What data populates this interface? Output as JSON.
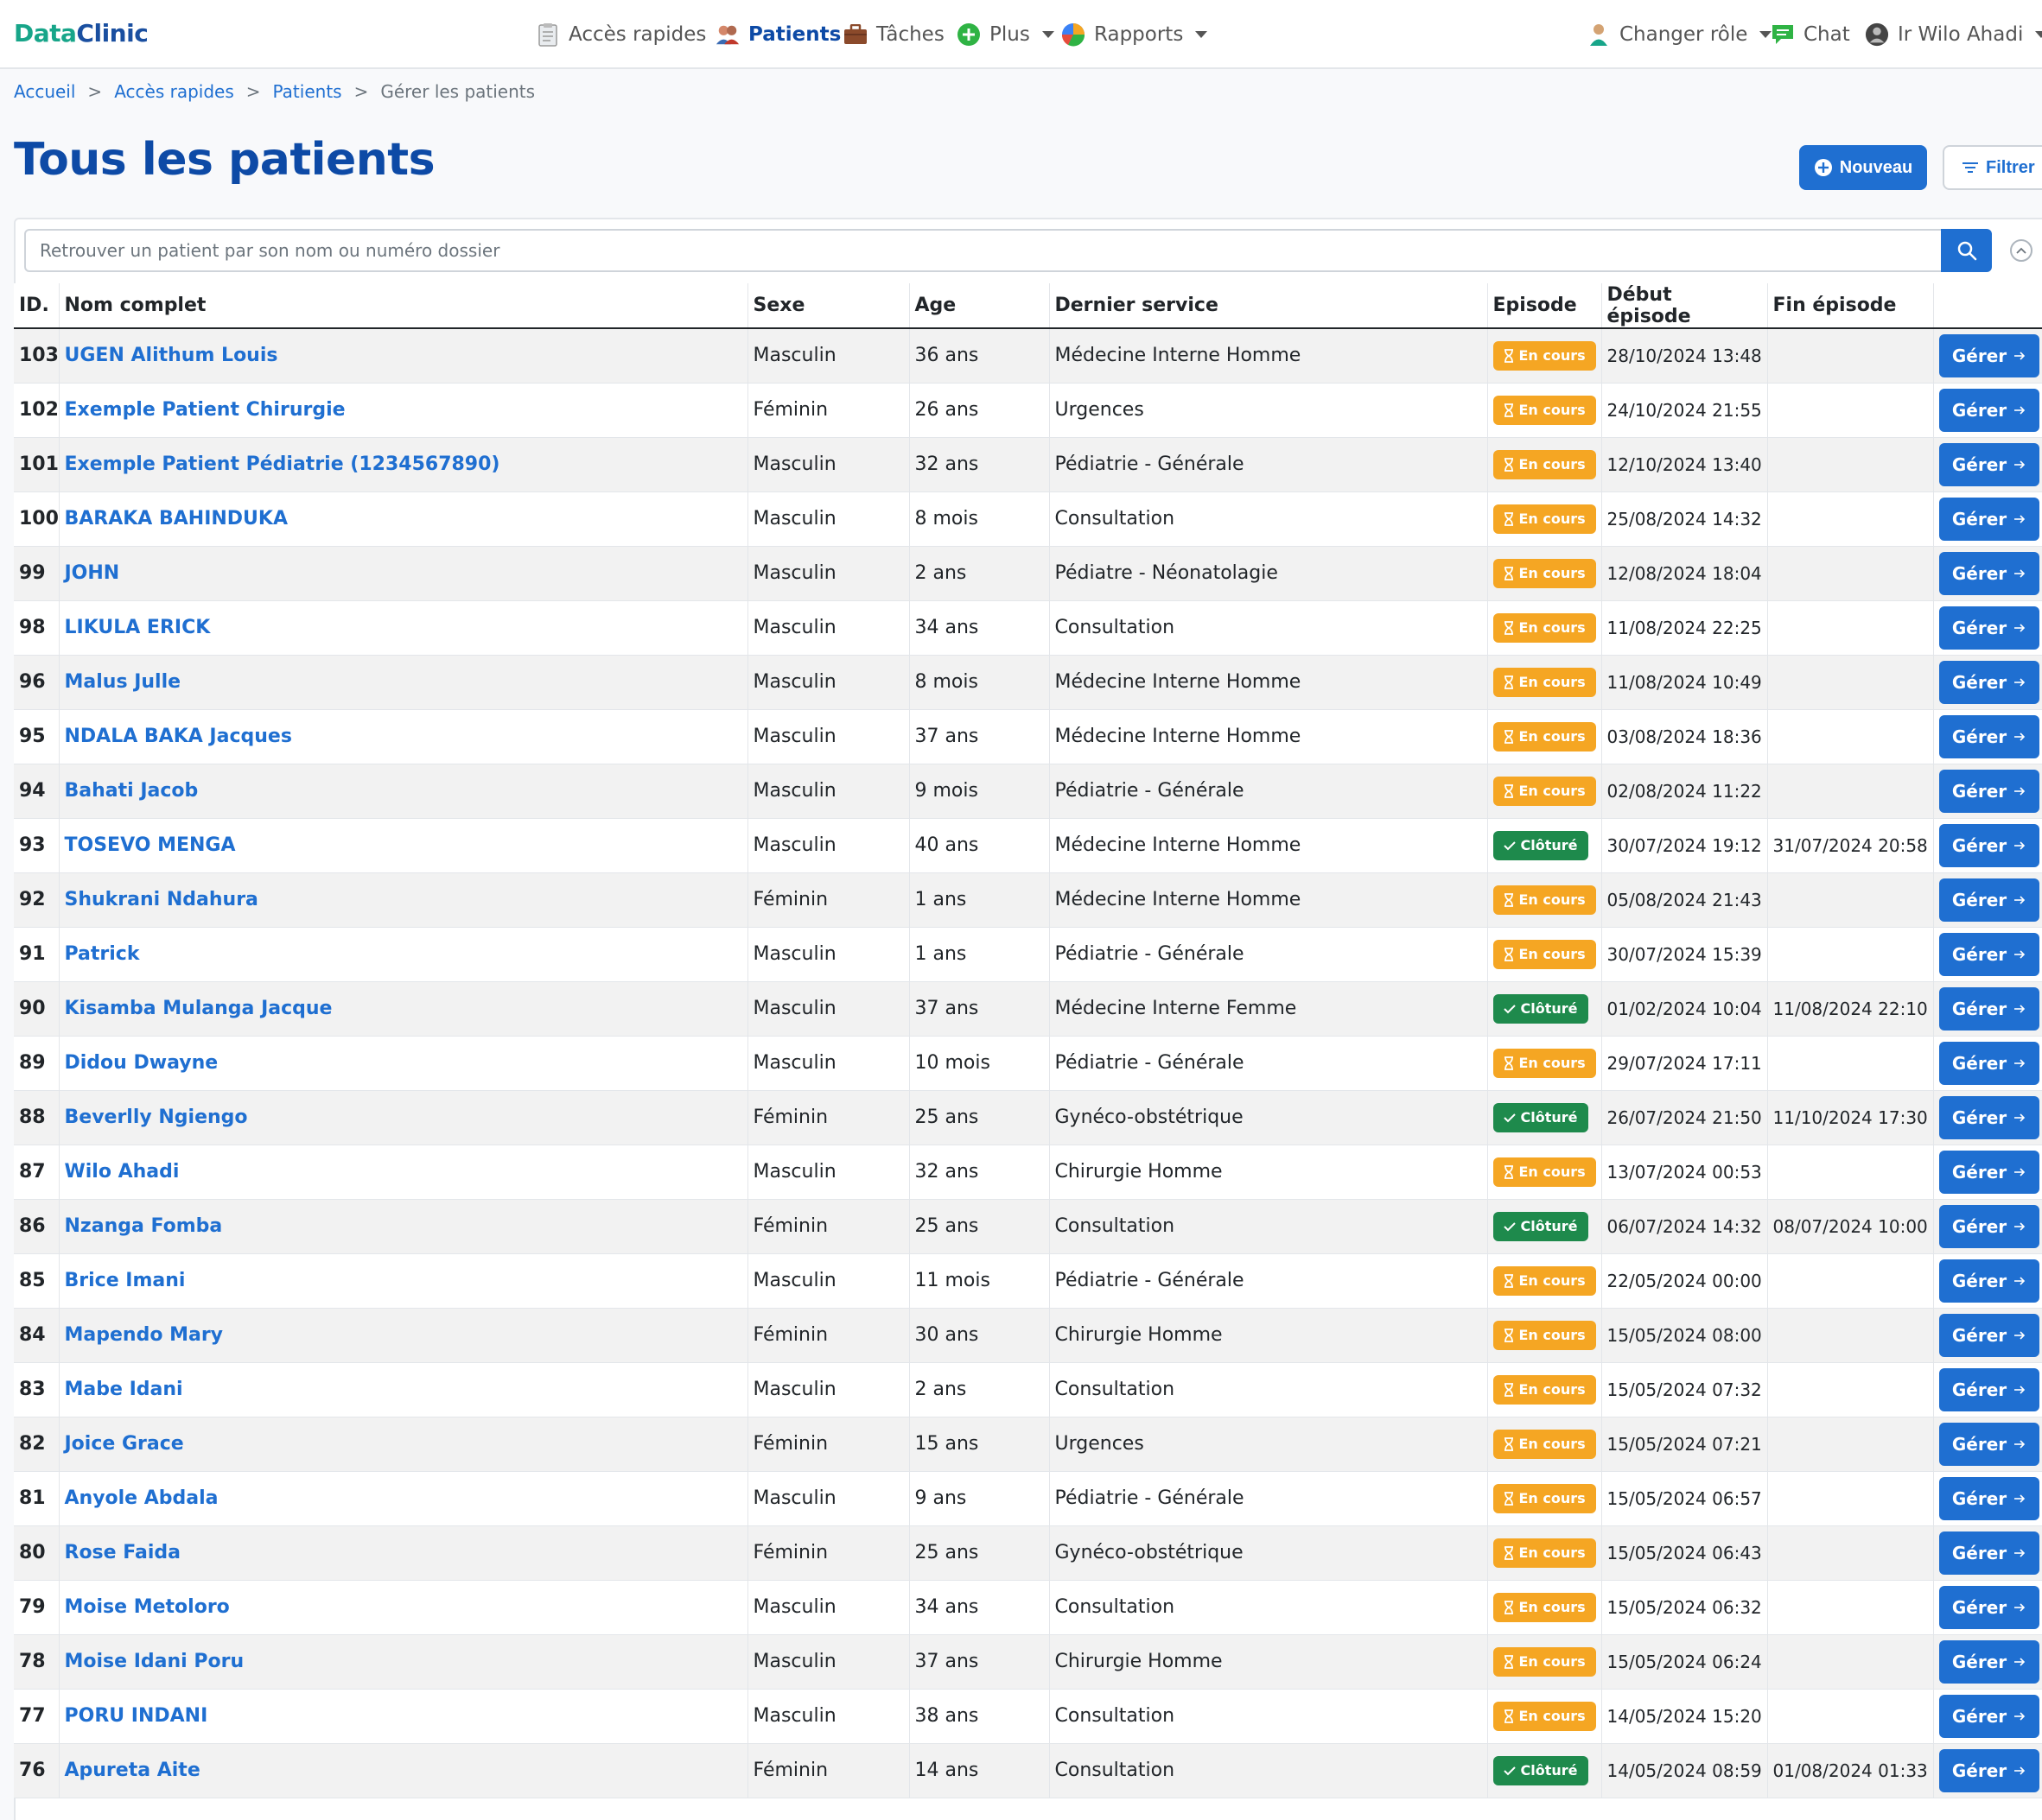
{
  "nav": {
    "brand_a": "Data",
    "brand_b": "Clinic",
    "quick_access": "Accès rapides",
    "patients": "Patients",
    "tasks": "Tâches",
    "more": "Plus",
    "reports": "Rapports",
    "change_role": "Changer rôle",
    "chat": "Chat",
    "user": "Ir Wilo Ahadi"
  },
  "breadcrumb": [
    "Accueil",
    "Accès rapides",
    "Patients",
    "Gérer les patients"
  ],
  "page": {
    "title": "Tous les patients",
    "new_label": "Nouveau",
    "filter_label": "Filtrer"
  },
  "search": {
    "placeholder": "Retrouver un patient par son nom ou numéro dossier"
  },
  "table": {
    "headers": [
      "ID.",
      "Nom complet",
      "Sexe",
      "Age",
      "Dernier service",
      "Episode",
      "Début épisode",
      "Fin épisode",
      ""
    ],
    "manage_label": "Gérer",
    "rows": [
      {
        "id": "103",
        "name": "UGEN Alithum Louis",
        "sex": "Masculin",
        "age": "36 ans",
        "service": "Médecine Interne Homme",
        "status": "En cours",
        "start": "28/10/2024 13:48",
        "end": ""
      },
      {
        "id": "102",
        "name": "Exemple Patient Chirurgie",
        "sex": "Féminin",
        "age": "26 ans",
        "service": "Urgences",
        "status": "En cours",
        "start": "24/10/2024 21:55",
        "end": ""
      },
      {
        "id": "101",
        "name": "Exemple Patient Pédiatrie (1234567890)",
        "sex": "Masculin",
        "age": "32 ans",
        "service": "Pédiatrie - Générale",
        "status": "En cours",
        "start": "12/10/2024 13:40",
        "end": ""
      },
      {
        "id": "100",
        "name": "BARAKA BAHINDUKA",
        "sex": "Masculin",
        "age": "8 mois",
        "service": "Consultation",
        "status": "En cours",
        "start": "25/08/2024 14:32",
        "end": ""
      },
      {
        "id": "99",
        "name": "JOHN",
        "sex": "Masculin",
        "age": "2 ans",
        "service": "Pédiatre - Néonatolagie",
        "status": "En cours",
        "start": "12/08/2024 18:04",
        "end": ""
      },
      {
        "id": "98",
        "name": "LIKULA ERICK",
        "sex": "Masculin",
        "age": "34 ans",
        "service": "Consultation",
        "status": "En cours",
        "start": "11/08/2024 22:25",
        "end": ""
      },
      {
        "id": "96",
        "name": "Malus Julle",
        "sex": "Masculin",
        "age": "8 mois",
        "service": "Médecine Interne Homme",
        "status": "En cours",
        "start": "11/08/2024 10:49",
        "end": ""
      },
      {
        "id": "95",
        "name": "NDALA BAKA Jacques",
        "sex": "Masculin",
        "age": "37 ans",
        "service": "Médecine Interne Homme",
        "status": "En cours",
        "start": "03/08/2024 18:36",
        "end": ""
      },
      {
        "id": "94",
        "name": "Bahati Jacob",
        "sex": "Masculin",
        "age": "9 mois",
        "service": "Pédiatrie - Générale",
        "status": "En cours",
        "start": "02/08/2024 11:22",
        "end": ""
      },
      {
        "id": "93",
        "name": "TOSEVO MENGA",
        "sex": "Masculin",
        "age": "40 ans",
        "service": "Médecine Interne Homme",
        "status": "Clôturé",
        "start": "30/07/2024 19:12",
        "end": "31/07/2024 20:58"
      },
      {
        "id": "92",
        "name": "Shukrani Ndahura",
        "sex": "Féminin",
        "age": "1 ans",
        "service": "Médecine Interne Homme",
        "status": "En cours",
        "start": "05/08/2024 21:43",
        "end": ""
      },
      {
        "id": "91",
        "name": "Patrick",
        "sex": "Masculin",
        "age": "1 ans",
        "service": "Pédiatrie - Générale",
        "status": "En cours",
        "start": "30/07/2024 15:39",
        "end": ""
      },
      {
        "id": "90",
        "name": "Kisamba Mulanga Jacque",
        "sex": "Masculin",
        "age": "37 ans",
        "service": "Médecine Interne Femme",
        "status": "Clôturé",
        "start": "01/02/2024 10:04",
        "end": "11/08/2024 22:10"
      },
      {
        "id": "89",
        "name": "Didou Dwayne",
        "sex": "Masculin",
        "age": "10 mois",
        "service": "Pédiatrie - Générale",
        "status": "En cours",
        "start": "29/07/2024 17:11",
        "end": ""
      },
      {
        "id": "88",
        "name": "Beverlly Ngiengo",
        "sex": "Féminin",
        "age": "25 ans",
        "service": "Gynéco-obstétrique",
        "status": "Clôturé",
        "start": "26/07/2024 21:50",
        "end": "11/10/2024 17:30"
      },
      {
        "id": "87",
        "name": "Wilo Ahadi",
        "sex": "Masculin",
        "age": "32 ans",
        "service": "Chirurgie Homme",
        "status": "En cours",
        "start": "13/07/2024 00:53",
        "end": ""
      },
      {
        "id": "86",
        "name": "Nzanga Fomba",
        "sex": "Féminin",
        "age": "25 ans",
        "service": "Consultation",
        "status": "Clôturé",
        "start": "06/07/2024 14:32",
        "end": "08/07/2024 10:00"
      },
      {
        "id": "85",
        "name": "Brice Imani",
        "sex": "Masculin",
        "age": "11 mois",
        "service": "Pédiatrie - Générale",
        "status": "En cours",
        "start": "22/05/2024 00:00",
        "end": ""
      },
      {
        "id": "84",
        "name": "Mapendo Mary",
        "sex": "Féminin",
        "age": "30 ans",
        "service": "Chirurgie Homme",
        "status": "En cours",
        "start": "15/05/2024 08:00",
        "end": ""
      },
      {
        "id": "83",
        "name": "Mabe Idani",
        "sex": "Masculin",
        "age": "2 ans",
        "service": "Consultation",
        "status": "En cours",
        "start": "15/05/2024 07:32",
        "end": ""
      },
      {
        "id": "82",
        "name": "Joice Grace",
        "sex": "Féminin",
        "age": "15 ans",
        "service": "Urgences",
        "status": "En cours",
        "start": "15/05/2024 07:21",
        "end": ""
      },
      {
        "id": "81",
        "name": "Anyole Abdala",
        "sex": "Masculin",
        "age": "9 ans",
        "service": "Pédiatrie - Générale",
        "status": "En cours",
        "start": "15/05/2024 06:57",
        "end": ""
      },
      {
        "id": "80",
        "name": "Rose Faida",
        "sex": "Féminin",
        "age": "25 ans",
        "service": "Gynéco-obstétrique",
        "status": "En cours",
        "start": "15/05/2024 06:43",
        "end": ""
      },
      {
        "id": "79",
        "name": "Moise Metoloro",
        "sex": "Masculin",
        "age": "34 ans",
        "service": "Consultation",
        "status": "En cours",
        "start": "15/05/2024 06:32",
        "end": ""
      },
      {
        "id": "78",
        "name": "Moise Idani Poru",
        "sex": "Masculin",
        "age": "37 ans",
        "service": "Chirurgie Homme",
        "status": "En cours",
        "start": "15/05/2024 06:24",
        "end": ""
      },
      {
        "id": "77",
        "name": "PORU INDANI",
        "sex": "Masculin",
        "age": "38 ans",
        "service": "Consultation",
        "status": "En cours",
        "start": "14/05/2024 15:20",
        "end": ""
      },
      {
        "id": "76",
        "name": "Apureta Aite",
        "sex": "Féminin",
        "age": "14 ans",
        "service": "Consultation",
        "status": "Clôturé",
        "start": "14/05/2024 08:59",
        "end": "01/08/2024 01:33"
      }
    ]
  },
  "colors": {
    "brand_blue": "#1f6fd1",
    "title_blue": "#0d4aa6",
    "badge_en_cours": "#f5a623",
    "badge_cloture": "#1e8a4c"
  },
  "icons": {
    "quick_access": "clipboard-icon",
    "patients": "people-icon",
    "tasks": "briefcase-icon",
    "more": "plus-circle-icon",
    "reports": "pie-chart-icon",
    "change_role": "user-role-icon",
    "chat": "chat-icon",
    "user": "avatar-icon",
    "search": "search-icon",
    "collapse": "chevron-up-icon",
    "in_progress": "hourglass-icon",
    "closed": "check-icon",
    "manage": "arrow-right-icon"
  }
}
